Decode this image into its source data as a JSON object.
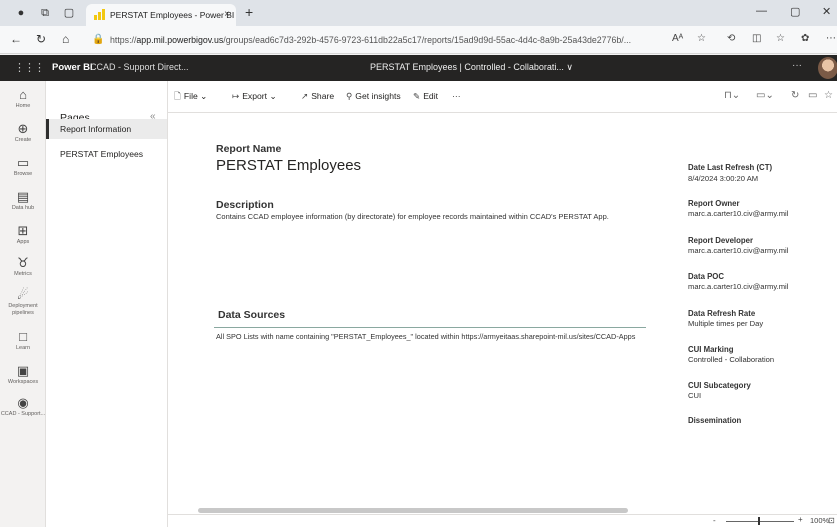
{
  "browser": {
    "tab_title": "PERSTAT Employees - Power BI",
    "tab_close": "×",
    "new_tab": "+",
    "url_prefix": "https://",
    "url_host": "app.mil.powerbigov.us",
    "url_path": "/groups/ead6c7d3-292b-4576-9723-611db22a5c17/reports/15ad9d9d-55ac-4d4c-8a9b-25a43de2776b/...",
    "read_aloud": "Aᴬ"
  },
  "pbi_header": {
    "brand": "Power BI",
    "workspace": "CCAD - Support Direct...",
    "report_title": "PERSTAT Employees  |  Controlled - Collaborati...  ∨"
  },
  "rail": [
    {
      "label": "Home",
      "icon": "home-icon",
      "glyph": "⌂"
    },
    {
      "label": "Create",
      "icon": "plus-circle-icon",
      "glyph": "⊕"
    },
    {
      "label": "Browse",
      "icon": "folder-icon",
      "glyph": "▭"
    },
    {
      "label": "Data hub",
      "icon": "data-hub-icon",
      "glyph": "▤"
    },
    {
      "label": "Apps",
      "icon": "apps-icon",
      "glyph": "⊞"
    },
    {
      "label": "Metrics",
      "icon": "trophy-icon",
      "glyph": "♉"
    },
    {
      "label": "Deployment pipelines",
      "icon": "rocket-icon",
      "glyph": "☄"
    },
    {
      "label": "Learn",
      "icon": "book-icon",
      "glyph": "□"
    },
    {
      "label": "Workspaces",
      "icon": "workspaces-icon",
      "glyph": "▣"
    },
    {
      "label": "CCAD - Support...",
      "icon": "workspace-badge-icon",
      "glyph": "◉"
    }
  ],
  "pages": {
    "header": "Pages",
    "collapse": "«",
    "items": [
      {
        "label": "Report Information",
        "active": true
      },
      {
        "label": "PERSTAT Employees",
        "active": false
      }
    ]
  },
  "toolbar": {
    "file": "File",
    "export": "Export",
    "share": "Share",
    "insights": "Get insights",
    "edit": "Edit",
    "more": "···"
  },
  "report": {
    "name_label": "Report Name",
    "name_value": "PERSTAT Employees",
    "desc_label": "Description",
    "desc_value": "Contains CCAD employee information (by directorate) for employee records maintained within CCAD's PERSTAT App.",
    "ds_label": "Data Sources",
    "ds_value": "All SPO Lists with name containing \"PERSTAT_Employees_\" located within https://armyeitaas.sharepoint-mil.us/sites/CCAD-Apps"
  },
  "meta": [
    {
      "label": "Date Last Refresh (CT)",
      "value": "8/4/2024 3:00:20 AM"
    },
    {
      "label": "Report Owner",
      "value": "marc.a.carter10.civ@army.mil"
    },
    {
      "label": "Report Developer",
      "value": "marc.a.carter10.civ@army.mil"
    },
    {
      "label": "Data POC",
      "value": "marc.a.carter10.civ@army.mil"
    },
    {
      "label": "Data Refresh Rate",
      "value": "Multiple times per Day"
    },
    {
      "label": "CUI Marking",
      "value": "Controlled - Collaboration"
    },
    {
      "label": "CUI Subcategory",
      "value": "CUI"
    },
    {
      "label": "Dissemination",
      "value": ""
    }
  ],
  "status": {
    "zoom": "100%",
    "minus": "-",
    "plus": "+"
  }
}
